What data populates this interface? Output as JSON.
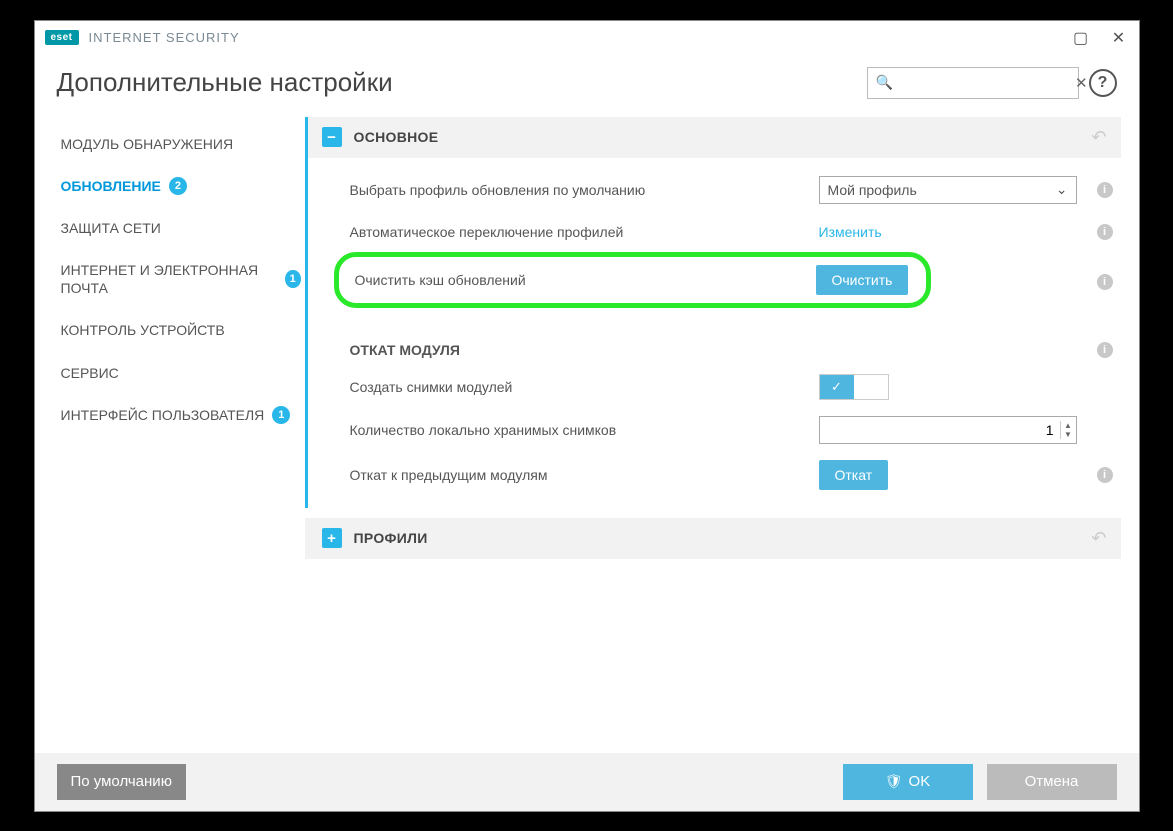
{
  "app": {
    "logo": "eset",
    "title": "INTERNET SECURITY"
  },
  "header": {
    "title": "Дополнительные настройки",
    "search_placeholder": ""
  },
  "sidebar": {
    "items": [
      {
        "label": "МОДУЛЬ ОБНАРУЖЕНИЯ",
        "badge": null
      },
      {
        "label": "ОБНОВЛЕНИЕ",
        "badge": "2"
      },
      {
        "label": "ЗАЩИТА СЕТИ",
        "badge": null
      },
      {
        "label": "ИНТЕРНЕТ И ЭЛЕКТРОННАЯ ПОЧТА",
        "badge": "1"
      },
      {
        "label": "КОНТРОЛЬ УСТРОЙСТВ",
        "badge": null
      },
      {
        "label": "СЕРВИС",
        "badge": null
      },
      {
        "label": "ИНТЕРФЕЙС ПОЛЬЗОВАТЕЛЯ",
        "badge": "1"
      }
    ]
  },
  "main": {
    "section1": {
      "title": "ОСНОВНОЕ",
      "profile_label": "Выбрать профиль обновления по умолчанию",
      "profile_value": "Мой профиль",
      "autoswitch_label": "Автоматическое переключение профилей",
      "autoswitch_link": "Изменить",
      "clear_label": "Очистить кэш обновлений",
      "clear_btn": "Очистить",
      "rollback_heading": "ОТКАТ МОДУЛЯ",
      "snapshot_label": "Создать снимки модулей",
      "count_label": "Количество локально хранимых снимков",
      "count_value": "1",
      "rollback_label": "Откат к предыдущим модулям",
      "rollback_btn": "Откат"
    },
    "section2": {
      "title": "ПРОФИЛИ"
    }
  },
  "footer": {
    "default_btn": "По умолчанию",
    "ok_btn": "OK",
    "cancel_btn": "Отмена"
  }
}
